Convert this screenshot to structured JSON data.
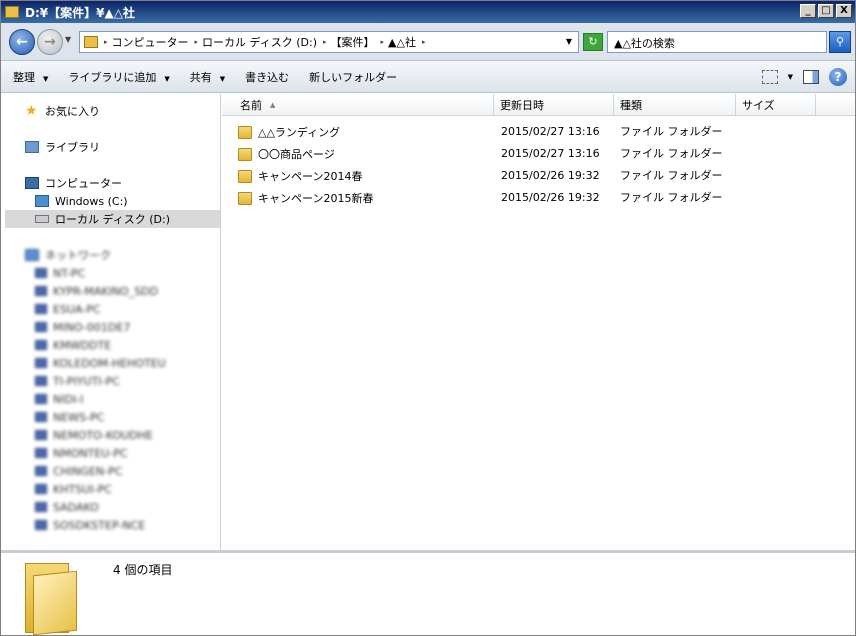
{
  "window": {
    "title": "D:¥【案件】¥▲△社",
    "buttons": {
      "minimize": "_",
      "maximize": "□",
      "close": "X"
    }
  },
  "address": {
    "back": "←",
    "forward": "→",
    "breadcrumb": [
      "コンピューター",
      "ローカル ディスク (D:)",
      "【案件】",
      "▲△社"
    ],
    "refresh": "↻",
    "search_placeholder": "▲△社の検索",
    "search_btn": "⚲"
  },
  "toolbar": {
    "organize": "整理",
    "add_to_library": "ライブラリに追加",
    "share": "共有",
    "burn": "書き込む",
    "new_folder": "新しいフォルダー",
    "help": "?"
  },
  "navpane": {
    "favorites": "お気に入り",
    "libraries": "ライブラリ",
    "computer": "コンピューター",
    "drive_c": "Windows (C:)",
    "drive_d": "ローカル ディスク (D:)",
    "network": "ネットワーク",
    "network_items": [
      "NT-PC",
      "KYPR-MAKINO_SDD",
      "ESUA-PC",
      "MINO-001DE7",
      "KMWDDTE",
      "KOLEDOM-HEHOTEU",
      "TI-PIYUTI-PC",
      "NIDI-I",
      "NEWS-PC",
      "NEMOTO-KOUDHE",
      "NMONTEU-PC",
      "CHINGEN-PC",
      "KHTSUI-PC",
      "SADAKO",
      "SOSDKSTEP-NCE"
    ]
  },
  "columns": {
    "name": "名前",
    "date": "更新日時",
    "type": "種類",
    "size": "サイズ"
  },
  "files": [
    {
      "name": "△△ランディング",
      "date": "2015/02/27 13:16",
      "type": "ファイル フォルダー"
    },
    {
      "name": "〇〇商品ページ",
      "date": "2015/02/27 13:16",
      "type": "ファイル フォルダー"
    },
    {
      "name": "キャンペーン2014春",
      "date": "2015/02/26 19:32",
      "type": "ファイル フォルダー"
    },
    {
      "name": "キャンペーン2015新春",
      "date": "2015/02/26 19:32",
      "type": "ファイル フォルダー"
    }
  ],
  "details": {
    "item_count": "4 個の項目"
  }
}
